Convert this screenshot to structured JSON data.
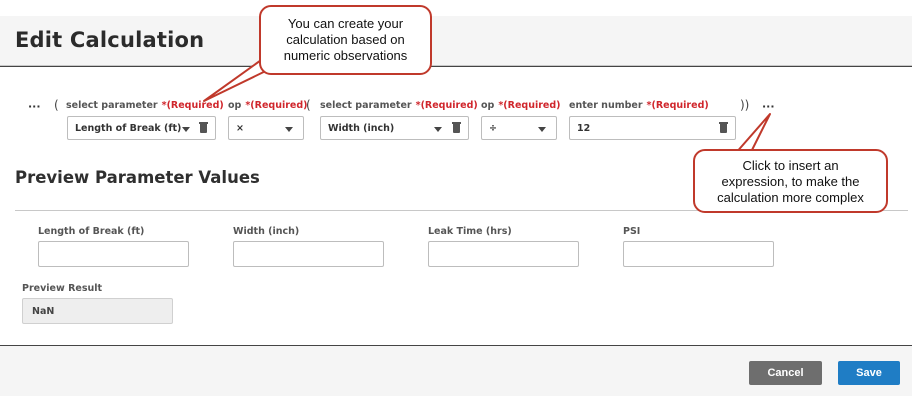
{
  "header": {
    "title": "Edit Calculation"
  },
  "builder": {
    "insert_dots": "···",
    "open_paren_1": "(",
    "open_paren_2": "(",
    "close_parens": "))",
    "required_text": "*(Required)",
    "fields": [
      {
        "label": "select parameter",
        "value": "Length of Break (ft)"
      },
      {
        "label": "op",
        "value": "×"
      },
      {
        "label": "select parameter",
        "value": "Width (inch)"
      },
      {
        "label": "op",
        "value": "÷"
      },
      {
        "label": "enter number",
        "value": "12"
      }
    ]
  },
  "preview": {
    "title": "Preview Parameter Values",
    "params": [
      "Length of Break (ft)",
      "Width (inch)",
      "Leak Time (hrs)",
      "PSI"
    ],
    "result_label": "Preview Result",
    "result_value": "NaN"
  },
  "footer": {
    "cancel_label": "Cancel",
    "save_label": "Save"
  },
  "callouts": {
    "top": [
      "You can create your",
      "calculation based on",
      "numeric observations"
    ],
    "right": [
      "Click to insert an",
      "expression, to make the",
      "calculation more complex"
    ]
  },
  "colors": {
    "required": "#d0262c",
    "save": "#1f7dc5",
    "cancel": "#6e6e6e",
    "callout_border": "#c0392b"
  }
}
